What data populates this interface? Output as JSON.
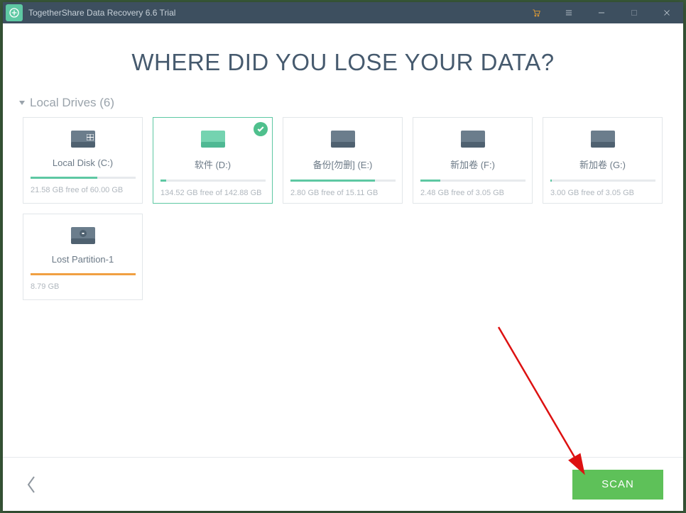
{
  "titlebar": {
    "title": "TogetherShare Data Recovery 6.6 Trial"
  },
  "main": {
    "heading": "WHERE DID YOU LOSE YOUR DATA?"
  },
  "section": {
    "label": "Local Drives (6)"
  },
  "drives": [
    {
      "label": "Local Disk (C:)",
      "free_text": "21.58 GB free of 60.00 GB",
      "fill_pct": 64,
      "selected": false,
      "icon": "windows-drive",
      "bar_color": "teal"
    },
    {
      "label": "软件 (D:)",
      "free_text": "134.52 GB free of 142.88 GB",
      "fill_pct": 6,
      "selected": true,
      "icon": "drive",
      "bar_color": "teal"
    },
    {
      "label": "备份[勿删] (E:)",
      "free_text": "2.80 GB free of 15.11 GB",
      "fill_pct": 81,
      "selected": false,
      "icon": "drive",
      "bar_color": "teal"
    },
    {
      "label": "新加卷 (F:)",
      "free_text": "2.48 GB free of 3.05 GB",
      "fill_pct": 19,
      "selected": false,
      "icon": "drive",
      "bar_color": "teal"
    },
    {
      "label": "新加卷 (G:)",
      "free_text": "3.00 GB free of 3.05 GB",
      "fill_pct": 2,
      "selected": false,
      "icon": "drive",
      "bar_color": "teal"
    },
    {
      "label": "Lost Partition-1",
      "free_text": "8.79 GB",
      "fill_pct": 100,
      "selected": false,
      "icon": "lost-drive",
      "bar_color": "orange"
    }
  ],
  "footer": {
    "scan_label": "SCAN"
  }
}
